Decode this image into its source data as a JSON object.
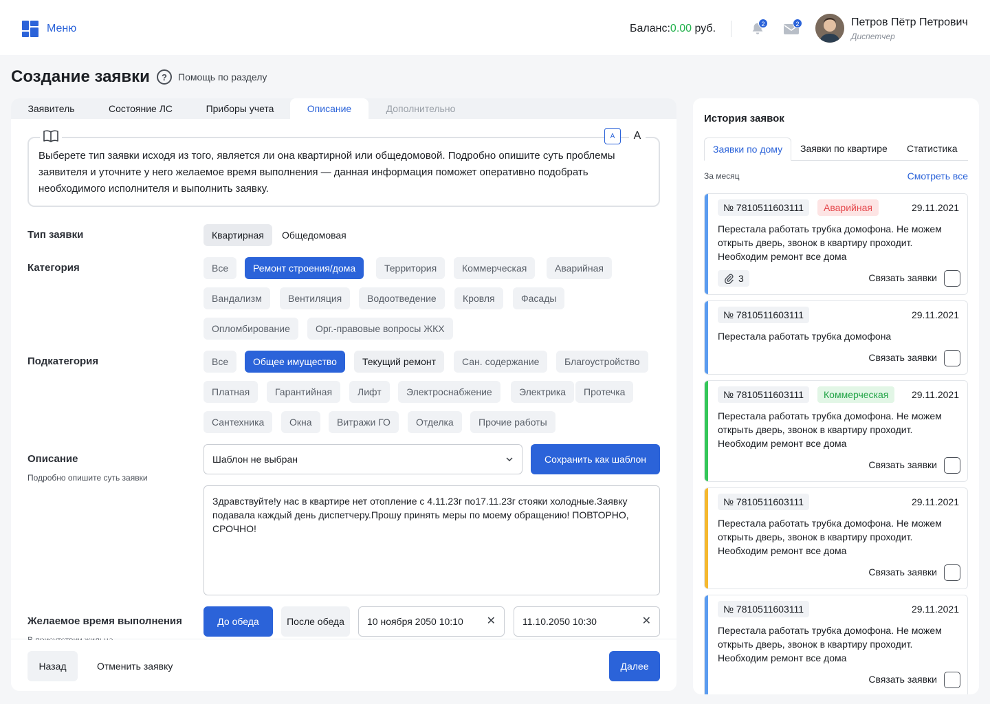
{
  "header": {
    "menu_label": "Меню",
    "balance_label": "Баланс:",
    "balance_value": "0.00",
    "balance_currency": " руб.",
    "notifications_count": "2",
    "messages_count": "2",
    "user_name": "Петров Пётр Петрович",
    "user_role": "Диспетчер"
  },
  "page": {
    "title": "Создание заявки",
    "help_label": "Помощь по разделу"
  },
  "tabs": [
    {
      "label": "Заявитель"
    },
    {
      "label": "Состояние ЛС"
    },
    {
      "label": "Приборы учета"
    },
    {
      "label": "Описание"
    },
    {
      "label": "Дополнительно"
    }
  ],
  "info": {
    "text": "Выберете тип заявки исходя из того, является ли она квартирной или общедомовой. Подробно опишите суть проблемы заявителя и уточните у него желаемое время выполнения — данная информация поможет оперативно подобрать необходимого исполнителя и выполнить заявку.",
    "font_small": "A",
    "font_large": "A"
  },
  "form": {
    "type_label": "Тип заявки",
    "types": [
      "Квартирная",
      "Общедомовая"
    ],
    "category_label": "Категория",
    "categories": [
      "Все",
      "Ремонт строения/дома",
      "Территория",
      "Коммерческая",
      "Аварийная",
      "Вандализм",
      "Вентиляция",
      "Водоотведение",
      "Кровля",
      "Фасады",
      "Опломбирование",
      "Орг.-правовые вопросы ЖКХ"
    ],
    "subcategory_label": "Подкатегория",
    "subcategories": [
      "Все",
      "Общее имущество",
      "Текущий ремонт",
      "Сан. содержание",
      "Благоустройство",
      "Платная",
      "Гарантийная",
      "Лифт",
      "Электроснабжение",
      "Электрика",
      "Протечка",
      "Сантехника",
      "Окна",
      "Витражи ГО",
      "Отделка",
      "Прочие работы"
    ],
    "description_label": "Описание",
    "description_sub": "Подробно опишите суть заявки",
    "template_value": "Шаблон не выбран",
    "save_template_label": "Сохранить как шаблон",
    "description_text": "Здравствуйте!у нас в квартире нет отопление с 4.11.23г по17.11.23г стояки холодные.Заявку подавала каждый день диспетчеру.Прошу принять меры по моему обращению! ПОВТОРНО, СРОЧНО!",
    "time_label": "Желаемое время выполнения",
    "time_sub": "В присутствии жильца",
    "before_lunch": "До обеда",
    "after_lunch": "После обеда",
    "date_from": "10 ноября 2050 10:10",
    "date_to": "11.10.2050 10:30"
  },
  "footer": {
    "back_label": "Назад",
    "cancel_label": "Отменить заявку",
    "next_label": "Далее"
  },
  "history": {
    "title": "История заявок",
    "tabs": [
      "Заявки по дому",
      "Заявки по квартире",
      "Статистика"
    ],
    "period": "За месяц",
    "see_all": "Смотреть все",
    "link_label": "Связать заявки",
    "cards": [
      {
        "num": "№ 7810511603111",
        "tag": "Аварийная",
        "date": "29.11.2021",
        "text": "Перестала работать трубка домофона. Не можем открыть дверь, звонок в квартиру проходит. Необходим ремонт все дома",
        "attach": "3",
        "stripe": "#5b9cf0",
        "tag_bg": "#fde4e4",
        "tag_color": "#e5484d"
      },
      {
        "num": "№ 7810511603111",
        "tag": "",
        "date": "29.11.2021",
        "text": "Перестала работать трубка домофона",
        "attach": "",
        "stripe": "#5b9cf0"
      },
      {
        "num": "№ 7810511603111",
        "tag": "Коммерческая",
        "date": "29.11.2021",
        "text": "Перестала работать трубка домофона. Не можем открыть дверь, звонок в квартиру проходит. Необходим ремонт все дома",
        "attach": "",
        "stripe": "#34c759",
        "tag_bg": "#e2f6e6",
        "tag_color": "#22a447"
      },
      {
        "num": "№ 7810511603111",
        "tag": "",
        "date": "29.11.2021",
        "text": "Перестала работать трубка домофона. Не можем открыть дверь, звонок в квартиру проходит. Необходим ремонт все дома",
        "attach": "",
        "stripe": "#f5b82e"
      },
      {
        "num": "№ 7810511603111",
        "tag": "",
        "date": "29.11.2021",
        "text": "Перестала работать трубка домофона. Не можем открыть дверь, звонок в квартиру проходит. Необходим ремонт все дома",
        "attach": "",
        "stripe": "#5b9cf0"
      }
    ]
  }
}
